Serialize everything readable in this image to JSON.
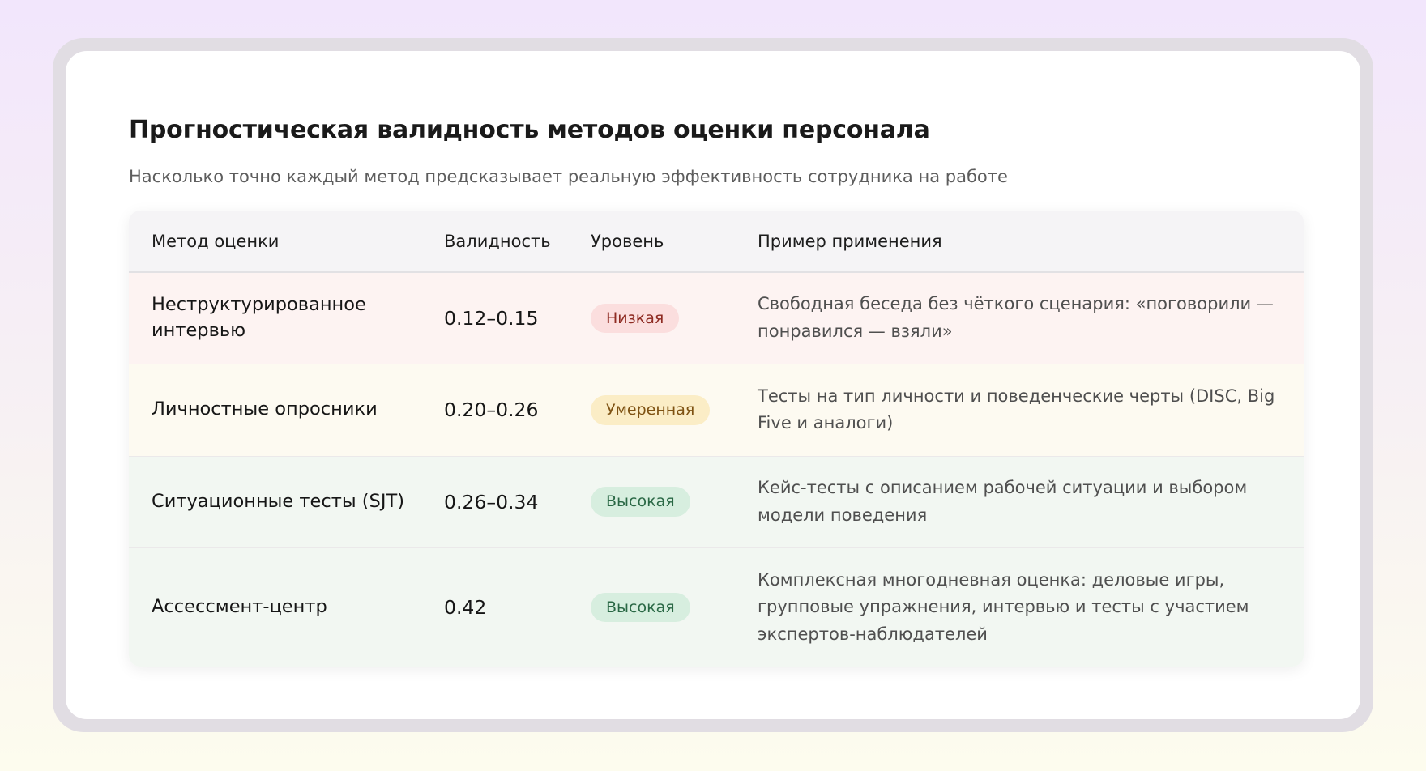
{
  "title": "Прогностическая валидность методов оценки персонала",
  "subtitle": "Насколько точно каждый метод предсказывает реальную эффективность сотрудника на работе",
  "table": {
    "headers": {
      "method": "Метод оценки",
      "validity": "Валидность",
      "level": "Уровень",
      "example": "Пример применения"
    },
    "rows": [
      {
        "method": "Неструктурированное интервью",
        "validity": "0.12–0.15",
        "level": "Низкая",
        "example": "Свободная беседа без чёткого сценария: «поговорили — понравился — взяли»"
      },
      {
        "method": "Личностные опросники",
        "validity": "0.20–0.26",
        "level": "Умеренная",
        "example": "Тесты на тип личности и поведенческие черты (DISC, Big Five и аналоги)"
      },
      {
        "method": "Ситуационные тесты (SJT)",
        "validity": "0.26–0.34",
        "level": "Высокая",
        "example": "Кейс-тесты с описанием рабочей ситуации и выбором модели поведения"
      },
      {
        "method": "Ассессмент-центр",
        "validity": "0.42",
        "level": "Высокая",
        "example": "Комплексная многодневная оценка: деловые игры, групповые упражнения, интервью и тесты с участием экспертов-наблюдателей"
      }
    ]
  },
  "colors": {
    "low_bg": "#fbdede",
    "low_text": "#8e2b22",
    "moderate_bg": "#fbedc6",
    "moderate_text": "#7e5212",
    "high_bg": "#d7eedf",
    "high_text": "#2a6845"
  }
}
